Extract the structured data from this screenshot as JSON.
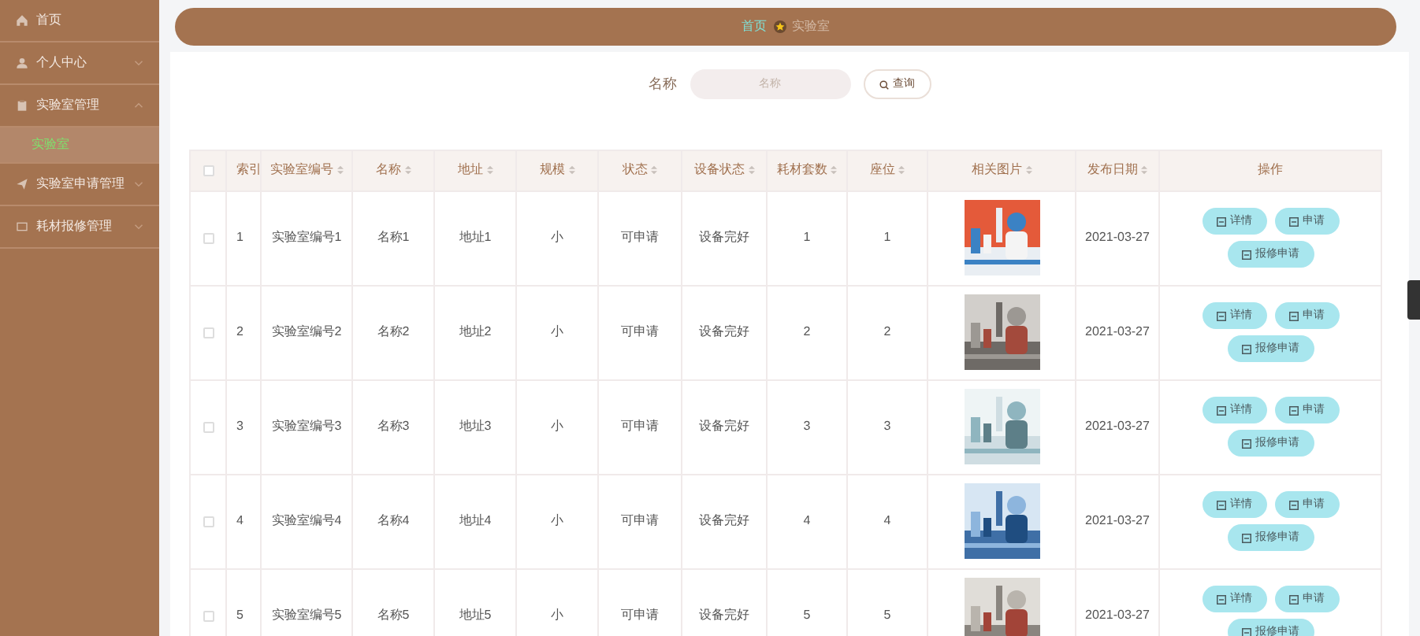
{
  "sidebar": {
    "items": [
      {
        "label": "首页",
        "selected": false
      },
      {
        "label": "个人中心",
        "expanded": false,
        "selected": false
      },
      {
        "label": "实验室管理",
        "expanded": true,
        "selected": false,
        "children": [
          {
            "label": "实验室",
            "selected": true
          }
        ]
      },
      {
        "label": "实验室申请管理",
        "expanded": false,
        "selected": false
      },
      {
        "label": "耗材报修管理",
        "expanded": false,
        "selected": false
      }
    ]
  },
  "breadcrumb": [
    "首页",
    "实验室"
  ],
  "search": {
    "label": "名称",
    "placeholder": "名称",
    "button": "查询"
  },
  "table": {
    "select_all_checked": false,
    "columns": [
      {
        "label": "索引",
        "sortable": false
      },
      {
        "label": "实验室编号",
        "sortable": true
      },
      {
        "label": "名称",
        "sortable": true
      },
      {
        "label": "地址",
        "sortable": true
      },
      {
        "label": "规模",
        "sortable": true
      },
      {
        "label": "状态",
        "sortable": true
      },
      {
        "label": "设备状态",
        "sortable": true
      },
      {
        "label": "耗材套数",
        "sortable": true
      },
      {
        "label": "座位",
        "sortable": true
      },
      {
        "label": "相关图片",
        "sortable": true
      },
      {
        "label": "发布日期",
        "sortable": true
      },
      {
        "label": "操作",
        "sortable": false
      }
    ],
    "rows": [
      {
        "checked": false,
        "cells": [
          "1",
          "实验室编号1",
          "名称1",
          "地址1",
          "小",
          "可申请",
          "设备完好",
          "1",
          "1"
        ],
        "date": "2021-03-27",
        "actions": [
          "详情",
          "申请",
          "报修申请"
        ]
      },
      {
        "checked": false,
        "cells": [
          "2",
          "实验室编号2",
          "名称2",
          "地址2",
          "小",
          "可申请",
          "设备完好",
          "2",
          "2"
        ],
        "date": "2021-03-27",
        "actions": [
          "详情",
          "申请",
          "报修申请"
        ]
      },
      {
        "checked": false,
        "cells": [
          "3",
          "实验室编号3",
          "名称3",
          "地址3",
          "小",
          "可申请",
          "设备完好",
          "3",
          "3"
        ],
        "date": "2021-03-27",
        "actions": [
          "详情",
          "申请",
          "报修申请"
        ]
      },
      {
        "checked": false,
        "cells": [
          "4",
          "实验室编号4",
          "名称4",
          "地址4",
          "小",
          "可申请",
          "设备完好",
          "4",
          "4"
        ],
        "date": "2021-03-27",
        "actions": [
          "详情",
          "申请",
          "报修申请"
        ]
      },
      {
        "checked": false,
        "cells": [
          "5",
          "实验室编号5",
          "名称5",
          "地址5",
          "小",
          "可申请",
          "设备完好",
          "5",
          "5"
        ],
        "date": "2021-03-27",
        "actions": [
          "详情",
          "申请",
          "报修申请"
        ]
      }
    ]
  }
}
